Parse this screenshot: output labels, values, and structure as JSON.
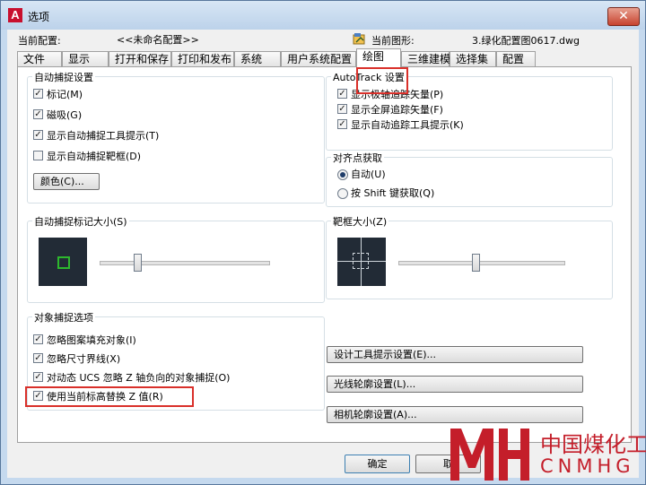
{
  "window": {
    "title": "选项",
    "app_icon": "A",
    "close_symbol": "✕"
  },
  "header": {
    "config_label": "当前配置:",
    "config_value": "<<未命名配置>>",
    "drawing_label": "当前图形:",
    "drawing_value": "3.绿化配置图0617.dwg"
  },
  "tabs": [
    {
      "label": "文件"
    },
    {
      "label": "显示"
    },
    {
      "label": "打开和保存"
    },
    {
      "label": "打印和发布"
    },
    {
      "label": "系统"
    },
    {
      "label": "用户系统配置"
    },
    {
      "label": "绘图",
      "active": true
    },
    {
      "label": "三维建模"
    },
    {
      "label": "选择集"
    },
    {
      "label": "配置"
    }
  ],
  "autosnap": {
    "title": "自动捕捉设置",
    "marker": {
      "label": "标记(M)",
      "checked": true
    },
    "magnet": {
      "label": "磁吸(G)",
      "checked": true
    },
    "tooltip": {
      "label": "显示自动捕捉工具提示(T)",
      "checked": true
    },
    "aperture": {
      "label": "显示自动捕捉靶框(D)",
      "checked": false
    },
    "color_button": "颜色(C)..."
  },
  "autotrack": {
    "title": "AutoTrack 设置",
    "polar": {
      "label": "显示极轴追踪矢量(P)",
      "checked": true
    },
    "fullscreen": {
      "label": "显示全屏追踪矢量(F)",
      "checked": true
    },
    "tooltip": {
      "label": "显示自动追踪工具提示(K)",
      "checked": true
    }
  },
  "alignment": {
    "title": "对齐点获取",
    "auto": {
      "label": "自动(U)",
      "selected": true
    },
    "shift": {
      "label": "按 Shift 键获取(Q)",
      "selected": false
    }
  },
  "marker_size": {
    "title": "自动捕捉标记大小(S)",
    "level": 0.25,
    "marker_color": "#2db82d"
  },
  "aperture_size": {
    "title": "靶框大小(Z)",
    "level": 0.45
  },
  "osnap": {
    "title": "对象捕捉选项",
    "ignore_hatch": {
      "label": "忽略图案填充对象(I)",
      "checked": true
    },
    "ignore_dim": {
      "label": "忽略尺寸界线(X)",
      "checked": true
    },
    "ignore_negz": {
      "label": "对动态 UCS 忽略 Z 轴负向的对象捕捉(O)",
      "checked": true
    },
    "replace_z": {
      "label": "使用当前标高替换 Z 值(R)",
      "checked": true
    }
  },
  "buttons": {
    "drafting_tooltip": "设计工具提示设置(E)...",
    "lightglyph": "光线轮廓设置(L)...",
    "camera_glyph": "相机轮廓设置(A)...",
    "ok": "确定",
    "cancel": "取"
  },
  "watermark": {
    "name_cn": "中国煤化工",
    "name_en": "CNMHG"
  },
  "colors": {
    "highlight": "#d9302a",
    "watermark": "#c41e2a"
  }
}
